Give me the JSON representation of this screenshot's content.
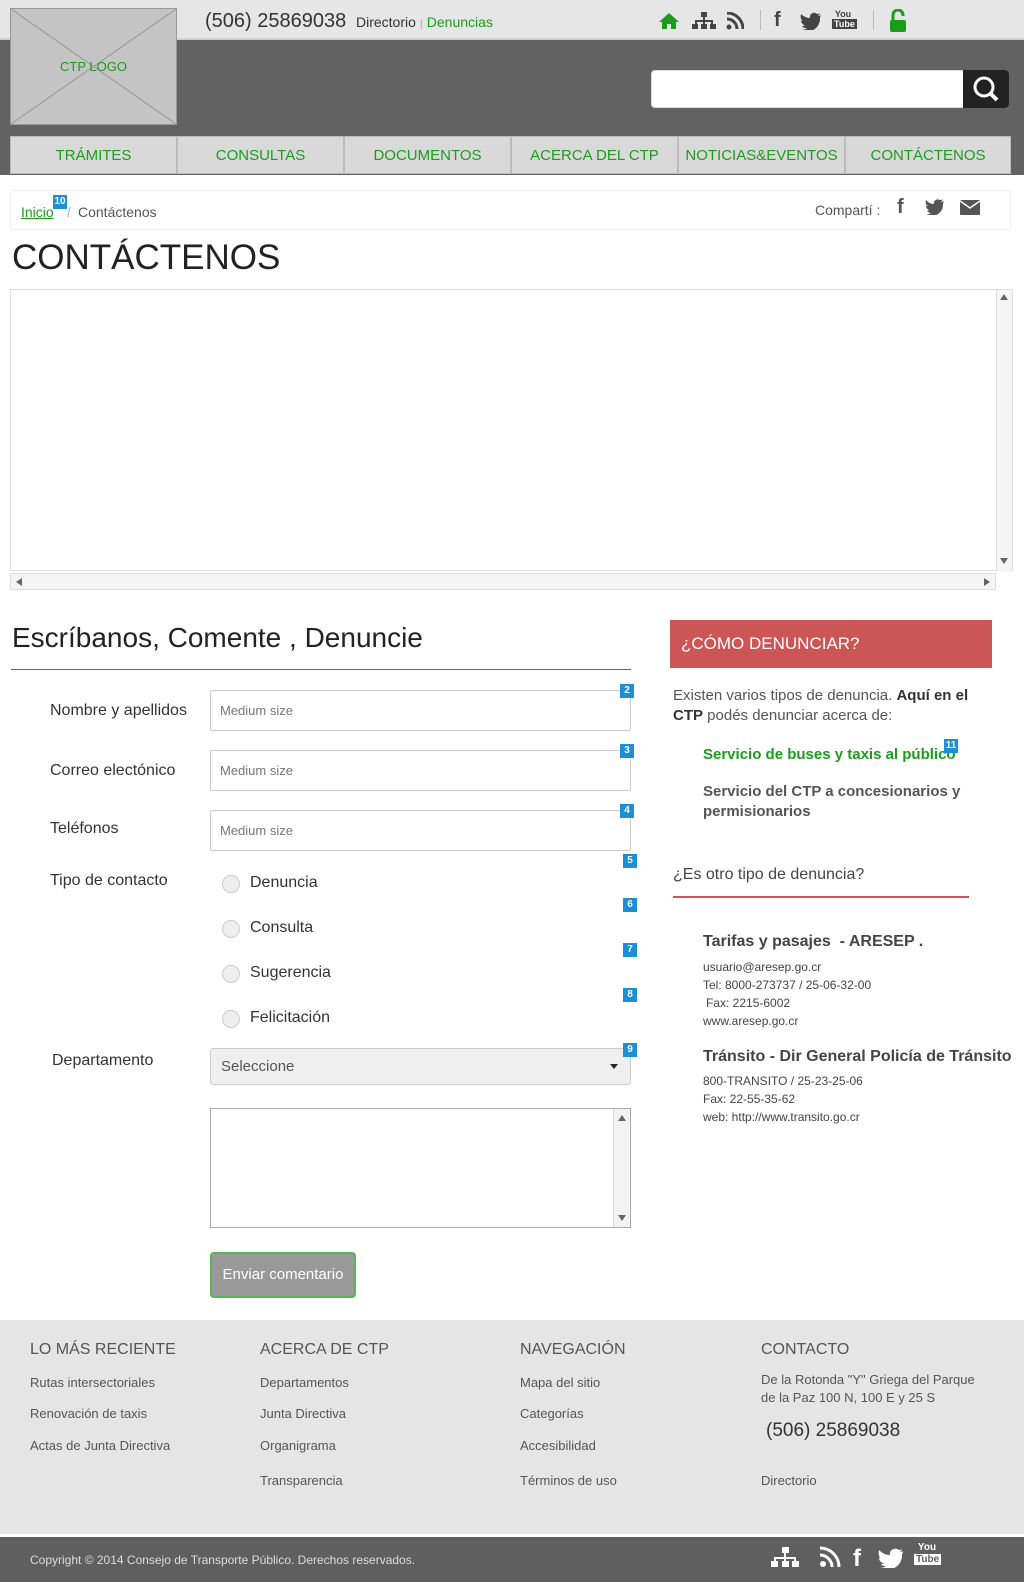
{
  "header": {
    "phone": "(506) 25869038",
    "links": [
      "Directorio",
      "Denuncias"
    ],
    "logo_text": "CTP LOGO",
    "search_placeholder": ""
  },
  "nav": {
    "items": [
      "TRÁMITES",
      "CONSULTAS",
      "DOCUMENTOS",
      "ACERCA DEL CTP",
      "NOTICIAS&EVENTOS",
      "CONTÁCTENOS"
    ]
  },
  "breadcrumb": {
    "home": "Inicio",
    "current": "Contáctenos",
    "badge": "10",
    "share_label": "Compartí :"
  },
  "page_title": "CONTÁCTENOS",
  "form": {
    "title": "Escríbanos, Comente , Denuncie",
    "fields": [
      {
        "label": "Nombre y apellidos",
        "placeholder": "Medium size",
        "badge": "2"
      },
      {
        "label": "Correo electónico",
        "placeholder": "Medium size",
        "badge": "3"
      },
      {
        "label": "Teléfonos",
        "placeholder": "Medium size",
        "badge": "4"
      }
    ],
    "contact_type_label": "Tipo de contacto",
    "contact_types": [
      {
        "label": "Denuncia",
        "badge": "5"
      },
      {
        "label": "Consulta",
        "badge": "6"
      },
      {
        "label": "Sugerencia",
        "badge": "7"
      },
      {
        "label": "Felicitación",
        "badge": "8"
      }
    ],
    "department_label": "Departamento",
    "department_select": "Seleccione",
    "department_badge": "9",
    "submit": "Enviar comentario"
  },
  "sidebar": {
    "heading": "¿CÓMO DENUNCIAR?",
    "intro_1": "Existen varios tipos de denuncia.",
    "intro_bold": "Aquí en el CTP",
    "intro_2": "podés denunciar acerca de:",
    "link_1": "Servicio de buses y taxis al público",
    "link_1_badge": "11",
    "link_2": "Servicio del CTP a concesionarios y permisionarios",
    "other_heading": "¿Es otro tipo de denuncia?",
    "inst_1": {
      "title": "Tarifas y pasajes",
      "org": "- ARESEP .",
      "lines": [
        "usuario@aresep.go.cr",
        "Tel: 8000-273737 / 25-06-32-00",
        "Fax: 2215-6002",
        "www.aresep.go.cr"
      ]
    },
    "inst_2": {
      "title": "Tránsito",
      "org": "- Dir General Policía de Tránsito",
      "lines": [
        "800-TRANSITO / 25-23-25-06",
        "Fax: 22-55-35-62",
        "web: http://www.transito.go.cr"
      ]
    }
  },
  "footer": {
    "col1": {
      "heading": "LO MÁS RECIENTE",
      "links": [
        "Rutas intersectoriales",
        "Renovación de taxis",
        "Actas de Junta Directiva"
      ]
    },
    "col2": {
      "heading": "ACERCA DE CTP",
      "links": [
        "Departamentos",
        "Junta Directiva",
        "Organigrama",
        "Transparencia"
      ]
    },
    "col3": {
      "heading": "NAVEGACIÓN",
      "links": [
        "Mapa del sitio",
        "Categorías",
        "Accesibilidad",
        "Términos de uso"
      ]
    },
    "col4": {
      "heading": "CONTACTO",
      "address_1": "De la Rotonda \"Y\" Griega del Parque",
      "address_2": "de la Paz 100 N, 100 E y 25 S",
      "phone": "(506) 25869038",
      "link": "Directorio"
    },
    "copyright": "Copyright © 2014 Consejo de Transporte Público. Derechos reservados."
  },
  "colors": {
    "accent_green": "#1a9e1a",
    "header_gray": "#626262",
    "denuncia_red": "#cc5555",
    "badge_blue": "#1d8fd6"
  },
  "icons": [
    "home-icon",
    "sitemap-icon",
    "rss-icon",
    "facebook-icon",
    "twitter-icon",
    "youtube-icon",
    "unlock-icon",
    "search-icon",
    "mail-icon"
  ]
}
